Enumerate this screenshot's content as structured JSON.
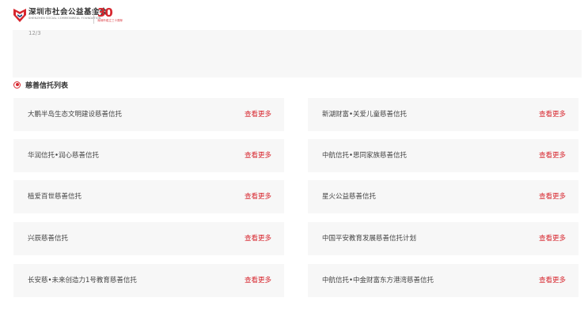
{
  "header": {
    "org_name": "深圳市社会公益基金会",
    "org_name_en": "SHENZHEN SOCIAL COMMONWEAL FOUNDATION",
    "anniversary_number": "30",
    "anniversary_sub": "深圳市成立三十周年",
    "accent_color": "#d7262e"
  },
  "previous_section": {
    "date_text": "12/3"
  },
  "trust_section": {
    "title": "慈善信托列表",
    "more_label": "查看更多",
    "items": [
      {
        "name": "大鹏半岛生态文明建设慈善信托"
      },
      {
        "name": "新湖财富•关爱儿童慈善信托"
      },
      {
        "name": "华润信托•润心慈善信托"
      },
      {
        "name": "中航信托•思同家族慈善信托"
      },
      {
        "name": "植爱百世慈善信托"
      },
      {
        "name": "星火公益慈善信托"
      },
      {
        "name": "兴辰慈善信托"
      },
      {
        "name": "中国平安教育发展慈善信托计划"
      },
      {
        "name": "长安慈•未来创造力1号教育慈善信托"
      },
      {
        "name": "中航信托•中金财富东方港湾慈善信托"
      }
    ]
  }
}
